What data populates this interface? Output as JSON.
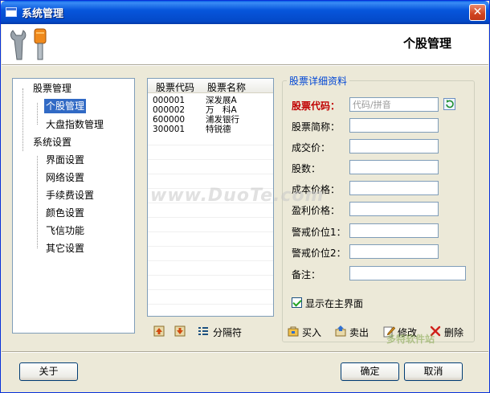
{
  "window": {
    "title": "系统管理",
    "close_label": "✕"
  },
  "header": {
    "title": "个股管理"
  },
  "tree": {
    "items": [
      {
        "label": "股票管理",
        "level": 0
      },
      {
        "label": "个股管理",
        "level": 1,
        "selected": true
      },
      {
        "label": "大盘指数管理",
        "level": 1
      },
      {
        "label": "系统设置",
        "level": 0
      },
      {
        "label": "界面设置",
        "level": 1
      },
      {
        "label": "网络设置",
        "level": 1
      },
      {
        "label": "手续费设置",
        "level": 1
      },
      {
        "label": "颜色设置",
        "level": 1
      },
      {
        "label": "飞信功能",
        "level": 1
      },
      {
        "label": "其它设置",
        "level": 1
      }
    ]
  },
  "stock_list": {
    "columns": [
      "股票代码",
      "股票名称"
    ],
    "rows": [
      [
        "000001",
        "深发展A"
      ],
      [
        "000002",
        "万　科A"
      ],
      [
        "600000",
        "浦发银行"
      ],
      [
        "300001",
        "特锐德"
      ]
    ]
  },
  "list_toolbar": {
    "separator_label": "分隔符"
  },
  "details": {
    "group_title": "股票详细资料",
    "code_label": "股票代码：",
    "code_placeholder": "代码/拼音",
    "abbr_label": "股票简称：",
    "price_label": "成交价：",
    "shares_label": "股数：",
    "cost_label": "成本价格：",
    "profit_label": "盈利价格：",
    "warn1_label": "警戒价位1：",
    "warn2_label": "警戒价位2：",
    "note_label": "备注：",
    "show_main_label": "显示在主界面",
    "show_main_checked": true
  },
  "actions": {
    "buy": "买入",
    "sell": "卖出",
    "edit": "修改",
    "delete": "删除"
  },
  "footer": {
    "about": "关于",
    "ok": "确定",
    "cancel": "取消"
  },
  "watermark": {
    "text": "www.DuoTe.com",
    "corner": "多特软件站"
  },
  "colors": {
    "selection": "#316ac5",
    "required_label": "#c00000",
    "group_title": "#0046d5"
  }
}
